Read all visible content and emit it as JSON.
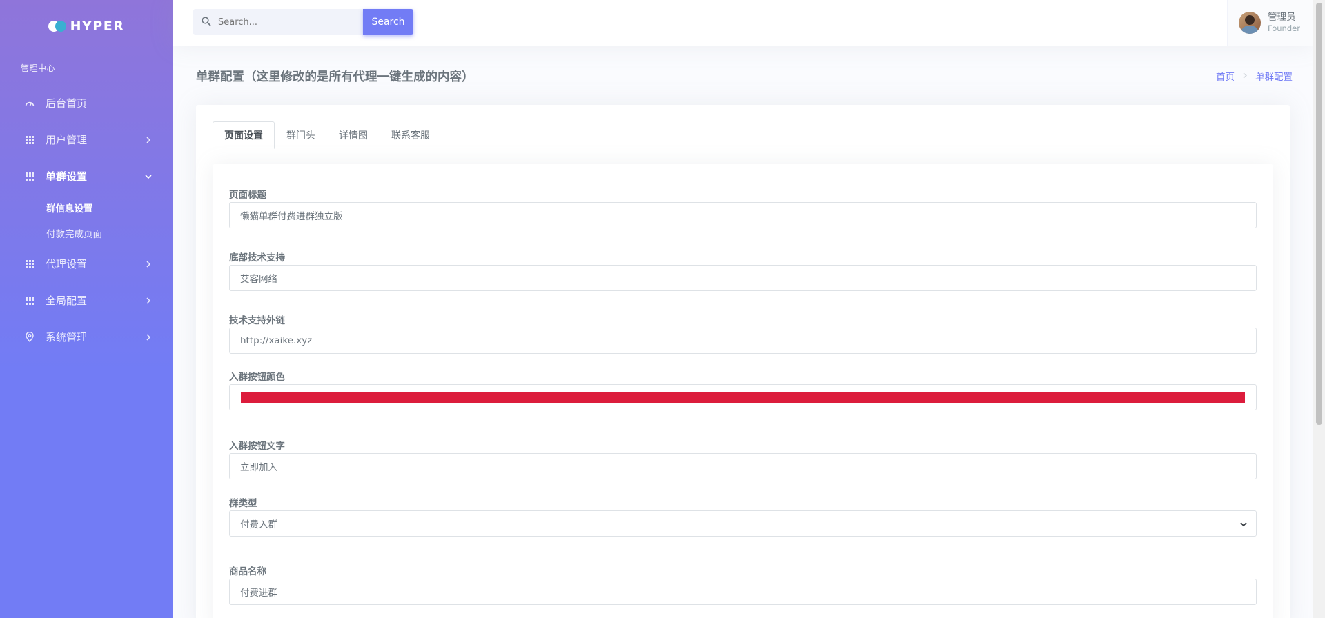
{
  "brand": {
    "name": "HYPER"
  },
  "sidebar": {
    "section_title": "管理中心",
    "items": [
      {
        "label": "后台首页",
        "icon": "dashboard-icon"
      },
      {
        "label": "用户管理",
        "icon": "grid-icon"
      },
      {
        "label": "单群设置",
        "icon": "grid-icon"
      },
      {
        "label": "代理设置",
        "icon": "grid-icon"
      },
      {
        "label": "全局配置",
        "icon": "grid-icon"
      },
      {
        "label": "系统管理",
        "icon": "map-pin-icon"
      }
    ],
    "subitems": [
      {
        "label": "群信息设置"
      },
      {
        "label": "付款完成页面"
      }
    ]
  },
  "topbar": {
    "search_placeholder": "Search...",
    "search_button": "Search",
    "user_name": "管理员",
    "user_role": "Founder"
  },
  "page": {
    "title": "单群配置（这里修改的是所有代理一键生成的内容）",
    "breadcrumb": [
      "首页",
      "单群配置"
    ]
  },
  "tabs": [
    "页面设置",
    "群门头",
    "详情图",
    "联系客服"
  ],
  "form": {
    "page_title": {
      "label": "页面标题",
      "value": "懒猫单群付费进群独立版"
    },
    "footer_support": {
      "label": "底部技术支持",
      "value": "艾客网络"
    },
    "support_link": {
      "label": "技术支持外链",
      "value": "http://xaike.xyz"
    },
    "join_button_color": {
      "label": "入群按钮颜色",
      "value": "#dc1c3c"
    },
    "join_button_text": {
      "label": "入群按钮文字",
      "value": "立即加入"
    },
    "group_type": {
      "label": "群类型",
      "value": "付费入群"
    },
    "product_name": {
      "label": "商品名称",
      "value": "付费进群"
    }
  },
  "colors": {
    "accent": "#727cf5",
    "sidebar_top": "#8f75da",
    "join_button": "#dc1c3c"
  }
}
